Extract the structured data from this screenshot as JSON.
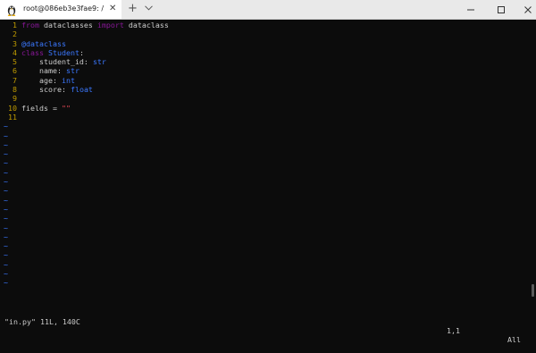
{
  "window": {
    "tab_title": "root@086eb3e3fae9: /",
    "tab_close_glyph": "✕",
    "new_tab_glyph": "+"
  },
  "editor": {
    "lines": [
      {
        "num": "1",
        "tokens": [
          {
            "t": "from",
            "c": "kw"
          },
          {
            "t": " dataclasses ",
            "c": ""
          },
          {
            "t": "import",
            "c": "kw"
          },
          {
            "t": " dataclass",
            "c": ""
          }
        ]
      },
      {
        "num": "2",
        "tokens": []
      },
      {
        "num": "3",
        "tokens": [
          {
            "t": "@dataclass",
            "c": "dec"
          }
        ]
      },
      {
        "num": "4",
        "tokens": [
          {
            "t": "class",
            "c": "kw"
          },
          {
            "t": " ",
            "c": ""
          },
          {
            "t": "Student",
            "c": "dec"
          },
          {
            "t": ":",
            "c": ""
          }
        ]
      },
      {
        "num": "5",
        "tokens": [
          {
            "t": "    student_id: ",
            "c": ""
          },
          {
            "t": "str",
            "c": "type"
          }
        ]
      },
      {
        "num": "6",
        "tokens": [
          {
            "t": "    name: ",
            "c": ""
          },
          {
            "t": "str",
            "c": "type"
          }
        ]
      },
      {
        "num": "7",
        "tokens": [
          {
            "t": "    age: ",
            "c": ""
          },
          {
            "t": "int",
            "c": "type"
          }
        ]
      },
      {
        "num": "8",
        "tokens": [
          {
            "t": "    score: ",
            "c": ""
          },
          {
            "t": "float",
            "c": "type"
          }
        ]
      },
      {
        "num": "9",
        "tokens": []
      },
      {
        "num": "10",
        "tokens": [
          {
            "t": "fields = ",
            "c": ""
          },
          {
            "t": "\"\"",
            "c": "str"
          }
        ]
      },
      {
        "num": "11",
        "tokens": []
      }
    ],
    "tilde": "~",
    "empty_line_count": 18
  },
  "status": {
    "file": "\"in.py\" 11L, 140C",
    "position": "1,1",
    "scroll": "All"
  },
  "colors": {
    "background": "#0c0c0c",
    "line_number": "#c19c00",
    "keyword": "#881798",
    "type": "#3b78ff",
    "string": "#e74856",
    "text": "#cccccc"
  }
}
